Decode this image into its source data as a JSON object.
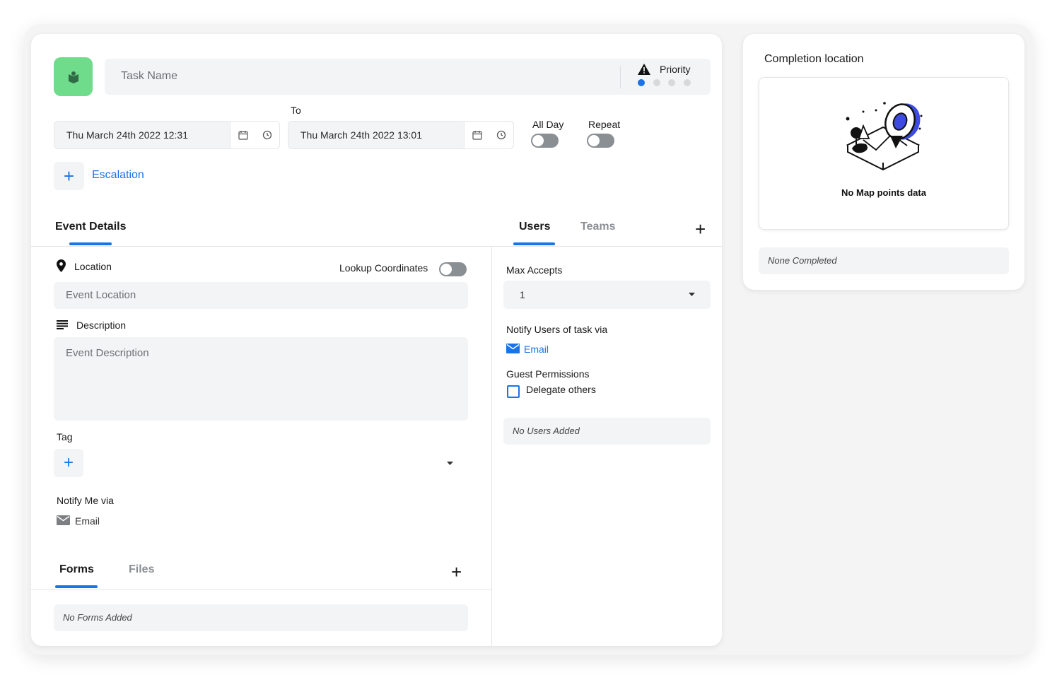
{
  "task": {
    "name_placeholder": "Task Name",
    "priority_label": "Priority",
    "priority_level": 1,
    "priority_max": 4,
    "accent_color": "#1a73e8",
    "avatar_color": "#6fdc8c"
  },
  "dates": {
    "to_label": "To",
    "start_value": "Thu March 24th 2022 12:31",
    "end_value": "Thu March 24th 2022 13:01",
    "all_day_label": "All Day",
    "repeat_label": "Repeat"
  },
  "escalation": {
    "label": "Escalation"
  },
  "event_tabs": {
    "event_details": "Event Details"
  },
  "location": {
    "label": "Location",
    "lookup_label": "Lookup Coordinates",
    "placeholder": "Event Location"
  },
  "description": {
    "label": "Description",
    "placeholder": "Event Description"
  },
  "tag": {
    "label": "Tag"
  },
  "notify_me": {
    "label": "Notify Me via",
    "email": "Email"
  },
  "bottom_tabs": {
    "forms": "Forms",
    "files": "Files",
    "empty_note": "No Forms Added"
  },
  "user_tabs": {
    "users": "Users",
    "teams": "Teams"
  },
  "max_accepts": {
    "label": "Max Accepts",
    "value": "1"
  },
  "notify_users": {
    "label": "Notify Users of task via",
    "email": "Email"
  },
  "guest": {
    "label": "Guest Permissions",
    "delegate": "Delegate others"
  },
  "users_empty_note": "No Users Added",
  "completion": {
    "title": "Completion location",
    "map_empty": "No Map points data",
    "note": "None Completed"
  }
}
